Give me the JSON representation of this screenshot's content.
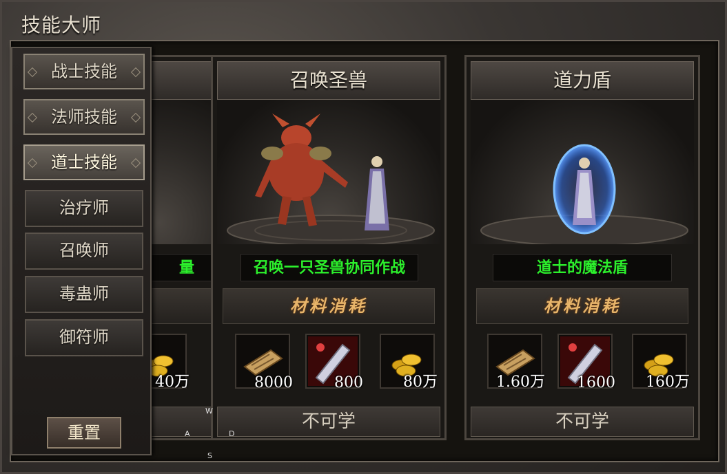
{
  "window": {
    "title": "技能大师"
  },
  "sidebar": {
    "tabs": [
      {
        "label": "战士技能",
        "state": "normal"
      },
      {
        "label": "法师技能",
        "state": "normal"
      },
      {
        "label": "道士技能",
        "state": "active"
      }
    ],
    "subclasses": [
      {
        "label": "治疗师"
      },
      {
        "label": "召唤师"
      },
      {
        "label": "毒蛊师"
      },
      {
        "label": "御符师"
      }
    ],
    "reset_label": "重置"
  },
  "partial_card": {
    "desc_fragment": "量",
    "gold_qty": "40万",
    "learn_label": ""
  },
  "cards": [
    {
      "name": "召唤圣兽",
      "description": "召唤一只圣兽协同作战",
      "materials_label": "材料消耗",
      "materials": [
        {
          "icon": "scroll-icon",
          "qty": "8000"
        },
        {
          "icon": "crystal-shard-icon",
          "qty": "800"
        },
        {
          "icon": "gold-coins-icon",
          "qty": "80万"
        }
      ],
      "learn_label": "不可学"
    },
    {
      "name": "道力盾",
      "description": "道士的魔法盾",
      "materials_label": "材料消耗",
      "materials": [
        {
          "icon": "scroll-icon",
          "qty": "1.60万"
        },
        {
          "icon": "crystal-shard-icon",
          "qty": "1600"
        },
        {
          "icon": "gold-coins-icon",
          "qty": "160万"
        }
      ],
      "learn_label": "不可学"
    }
  ],
  "wasd_overlay": {
    "w": "W",
    "a": "A",
    "s": "S",
    "d": "D"
  },
  "colors": {
    "desc_text": "#2cf02c",
    "materials_text": "#e8b56a",
    "frame": "#4a4440"
  }
}
